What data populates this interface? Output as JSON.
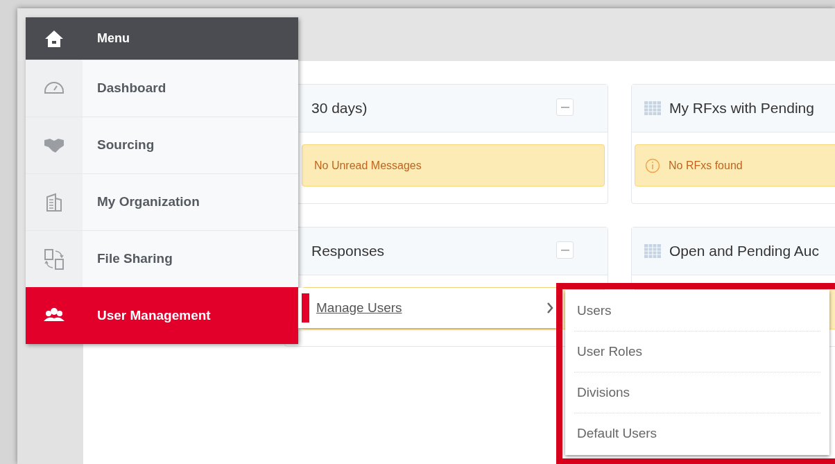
{
  "menu": {
    "title": "Menu",
    "items": [
      {
        "label": "Dashboard",
        "selected": false
      },
      {
        "label": "Sourcing",
        "selected": false
      },
      {
        "label": "My Organization",
        "selected": false
      },
      {
        "label": "File Sharing",
        "selected": false
      },
      {
        "label": "User Management",
        "selected": true
      }
    ]
  },
  "cards": [
    {
      "kind": "collapsible",
      "title": "30 days)",
      "message": "No Unread Messages"
    },
    {
      "kind": "table",
      "title": "My RFxs with Pending",
      "message": "No RFxs found"
    },
    {
      "kind": "collapsible",
      "title": "Responses"
    },
    {
      "kind": "table",
      "title": "Open and Pending Auc"
    }
  ],
  "submenu": {
    "label": "Manage Users",
    "items": [
      "Users",
      "User Roles",
      "Divisions",
      "Default Users"
    ],
    "highlighted": true
  }
}
